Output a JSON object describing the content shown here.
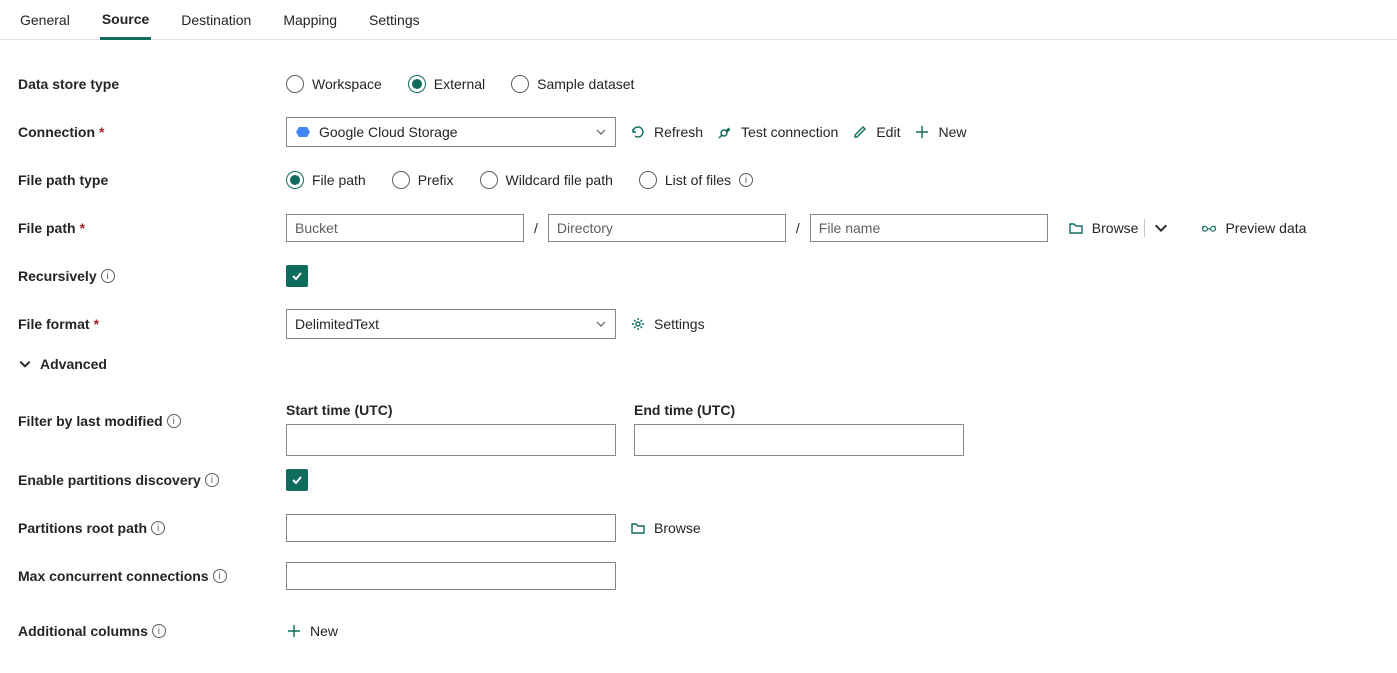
{
  "tabs": [
    "General",
    "Source",
    "Destination",
    "Mapping",
    "Settings"
  ],
  "activeTab": 1,
  "labels": {
    "dataStoreType": "Data store type",
    "connection": "Connection",
    "filePathType": "File path type",
    "filePath": "File path",
    "recursively": "Recursively",
    "fileFormat": "File format",
    "advanced": "Advanced",
    "filterByLastModified": "Filter by last modified",
    "enablePartitions": "Enable partitions discovery",
    "partitionsRootPath": "Partitions root path",
    "maxConcurrent": "Max concurrent connections",
    "additionalColumns": "Additional columns",
    "startTime": "Start time (UTC)",
    "endTime": "End time (UTC)"
  },
  "dataStoreTypes": [
    "Workspace",
    "External",
    "Sample dataset"
  ],
  "dataStoreSelected": 1,
  "connection": {
    "value": "Google Cloud Storage",
    "actions": {
      "refresh": "Refresh",
      "test": "Test connection",
      "edit": "Edit",
      "new": "New"
    }
  },
  "filePathTypes": [
    "File path",
    "Prefix",
    "Wildcard file path",
    "List of files"
  ],
  "filePathTypeSelected": 0,
  "filePath": {
    "bucketPh": "Bucket",
    "dirPh": "Directory",
    "filePh": "File name",
    "browse": "Browse",
    "preview": "Preview data"
  },
  "recursivelyChecked": true,
  "fileFormat": {
    "value": "DelimitedText",
    "settings": "Settings"
  },
  "partitionsChecked": true,
  "partitionsBrowse": "Browse",
  "newColumn": "New"
}
